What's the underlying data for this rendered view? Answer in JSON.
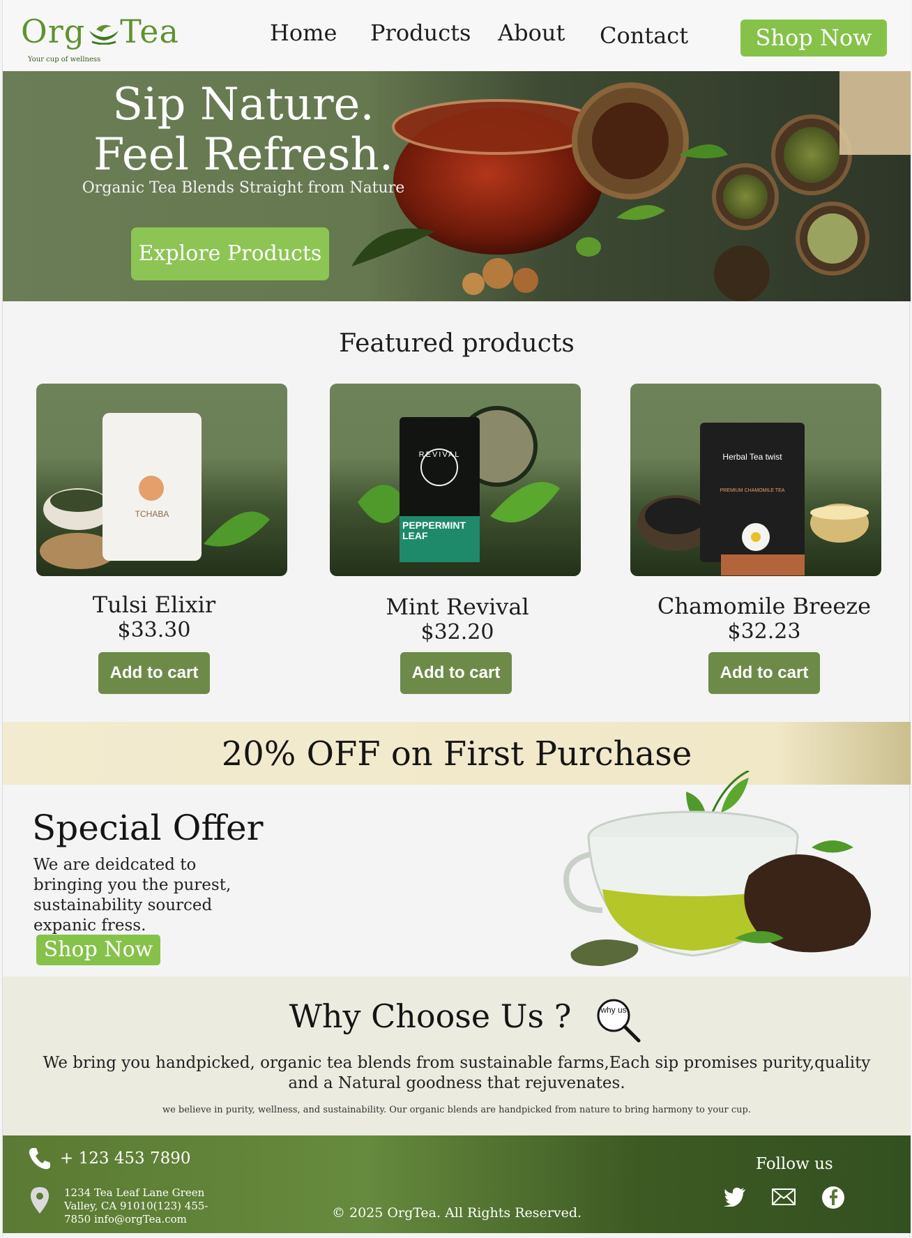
{
  "brand": {
    "logo_text_left": "Org",
    "logo_text_right": "Tea",
    "tagline": "Your cup of wellness"
  },
  "nav": {
    "items": [
      "Home",
      "Products",
      "About",
      "Contact"
    ],
    "cta": "Shop Now"
  },
  "hero": {
    "line1": "Sip Nature.",
    "line2": "Feel Refresh.",
    "subtitle": "Organic Tea Blends Straight from Nature",
    "button": "Explore Products"
  },
  "featured": {
    "title": "Featured products",
    "products": [
      {
        "name": "Tulsi Elixir",
        "price": "$33.30",
        "button": "Add to cart",
        "package_label": "TCHABA"
      },
      {
        "name": "Mint Revival",
        "price": "$32.20",
        "button": "Add to cart",
        "package_label": "PEPPERMINT LEAF",
        "package_brand": "REVIVAL"
      },
      {
        "name": "Chamomile Breeze",
        "price": "$32.23",
        "button": "Add to cart",
        "package_label": "Herbal Tea twist",
        "package_sub": "PREMIUM CHAMOMILE TEA"
      }
    ]
  },
  "promo": {
    "banner": "20% OFF on First Purchase",
    "title": "Special Offer",
    "description": "We are deidcated to bringing you the purest, sustainability sourced  expanic fress.",
    "button": "Shop Now"
  },
  "why": {
    "title": "Why Choose Us ?",
    "badge": "why us",
    "text": "We bring you handpicked, organic tea blends from sustainable farms,Each sip promises purity,quality and a Natural goodness that rejuvenates.",
    "small": "we believe in purity, wellness, and sustainability. Our organic blends are handpicked from nature to bring harmony to your cup."
  },
  "footer": {
    "phone": "+ 123 453 7890",
    "address": "1234 Tea Leaf Lane Green Valley, CA 91010(123) 455-7850 info@orgTea.com",
    "copyright": "© 2025 OrgTea. All Rights Reserved.",
    "follow": "Follow us",
    "social_icons": [
      "twitter-icon",
      "mail-icon",
      "facebook-icon"
    ]
  },
  "colors": {
    "accent_green": "#86c24a",
    "cart_green": "#6d8a49",
    "hero_green": "#6b7d56",
    "promo_cream": "#f2ebcf"
  }
}
